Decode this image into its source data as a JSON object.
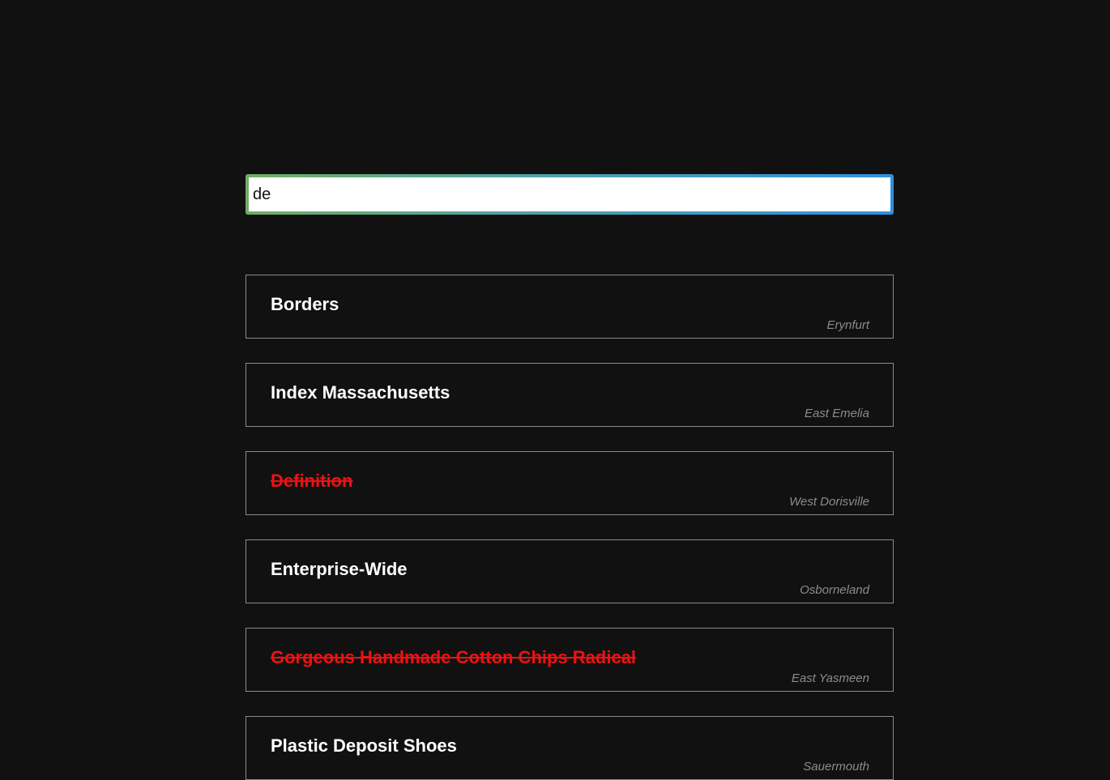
{
  "search": {
    "value": "de",
    "placeholder": ""
  },
  "items": [
    {
      "title": "Borders",
      "location": "Erynfurt",
      "struck": false
    },
    {
      "title": "Index Massachusetts",
      "location": "East Emelia",
      "struck": false
    },
    {
      "title": "Definition",
      "location": "West Dorisville",
      "struck": true
    },
    {
      "title": "Enterprise-Wide",
      "location": "Osborneland",
      "struck": false
    },
    {
      "title": "Gorgeous Handmade Cotton Chips Radical",
      "location": "East Yasmeen",
      "struck": true
    },
    {
      "title": "Plastic Deposit Shoes",
      "location": "Sauermouth",
      "struck": false
    }
  ],
  "colors": {
    "background": "#111111",
    "struck_text": "#ee1111",
    "focus_gradient_start": "#6fae63",
    "focus_gradient_end": "#2e90e0"
  }
}
